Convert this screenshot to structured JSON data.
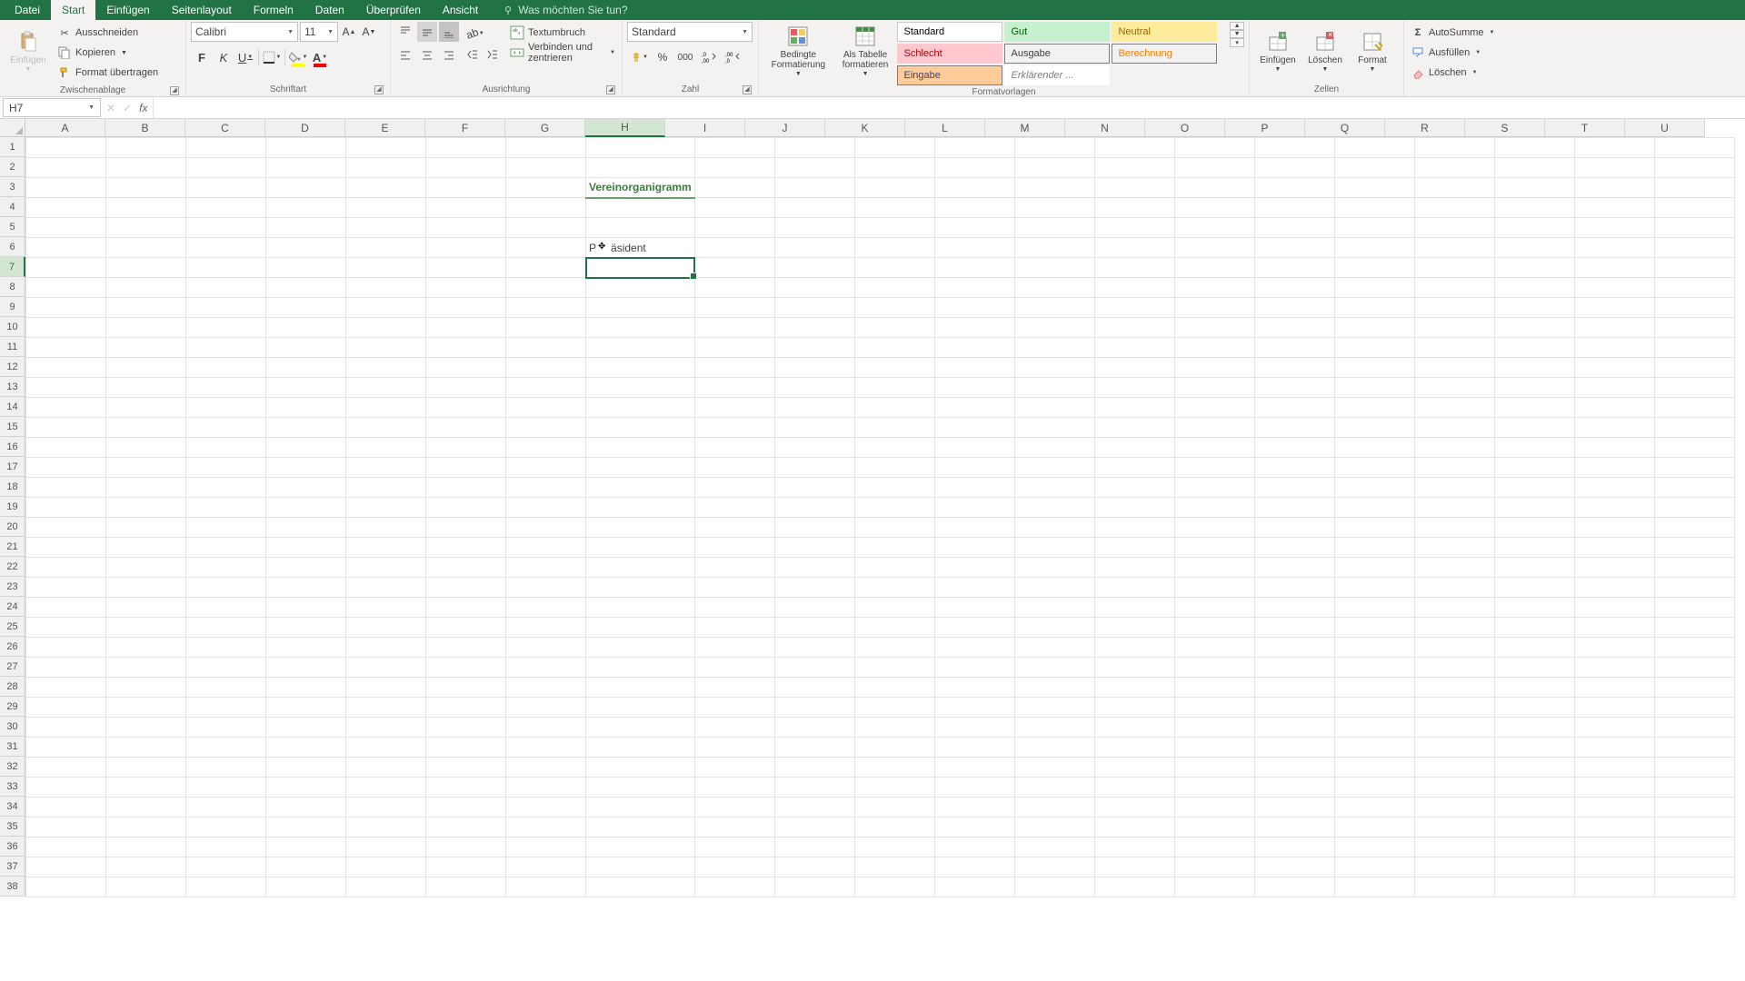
{
  "tabs": [
    "Datei",
    "Start",
    "Einfügen",
    "Seitenlayout",
    "Formeln",
    "Daten",
    "Überprüfen",
    "Ansicht"
  ],
  "active_tab": "Start",
  "tell_me": "Was möchten Sie tun?",
  "clipboard": {
    "paste": "Einfügen",
    "cut": "Ausschneiden",
    "copy": "Kopieren",
    "format_painter": "Format übertragen",
    "group": "Zwischenablage"
  },
  "font": {
    "name": "Calibri",
    "size": "11",
    "bold": "F",
    "italic": "K",
    "underline": "U",
    "group": "Schriftart"
  },
  "alignment": {
    "wrap": "Textumbruch",
    "merge": "Verbinden und zentrieren",
    "group": "Ausrichtung"
  },
  "number": {
    "format": "Standard",
    "group": "Zahl"
  },
  "styles": {
    "cond": "Bedingte\nFormatierung",
    "table": "Als Tabelle\nformatieren",
    "chips": [
      {
        "label": "Standard",
        "bg": "#ffffff",
        "color": "#000",
        "border": "#c9c9c9"
      },
      {
        "label": "Gut",
        "bg": "#c6efce",
        "color": "#006100",
        "border": "#c6efce"
      },
      {
        "label": "Neutral",
        "bg": "#ffeb9c",
        "color": "#9c6500",
        "border": "#ffeb9c"
      },
      {
        "label": "Schlecht",
        "bg": "#ffc7ce",
        "color": "#9c0006",
        "border": "#ffc7ce"
      },
      {
        "label": "Ausgabe",
        "bg": "#f2f2f2",
        "color": "#3f3f3f",
        "border": "#7f7f7f"
      },
      {
        "label": "Berechnung",
        "bg": "#f2f2f2",
        "color": "#fa7d00",
        "border": "#7f7f7f"
      },
      {
        "label": "Eingabe",
        "bg": "#ffcc99",
        "color": "#3f3f76",
        "border": "#7f7f7f"
      },
      {
        "label": "Erklärender ...",
        "bg": "#ffffff",
        "color": "#7f7f7f",
        "border": "#ffffff",
        "italic": true
      }
    ],
    "group": "Formatvorlagen"
  },
  "cells_group": {
    "insert": "Einfügen",
    "delete": "Löschen",
    "format": "Format",
    "group": "Zellen"
  },
  "editing": {
    "sum": "AutoSumme",
    "fill": "Ausfüllen",
    "clear": "Löschen"
  },
  "name_box": "H7",
  "formula": "",
  "columns": [
    "A",
    "B",
    "C",
    "D",
    "E",
    "F",
    "G",
    "H",
    "I",
    "J",
    "K",
    "L",
    "M",
    "N",
    "O",
    "P",
    "Q",
    "R",
    "S",
    "T",
    "U"
  ],
  "selected_col_idx": 7,
  "selected_row_idx": 6,
  "row_count": 38,
  "cell_H3": "Vereinorganigramm",
  "cell_H6": "Präsident"
}
